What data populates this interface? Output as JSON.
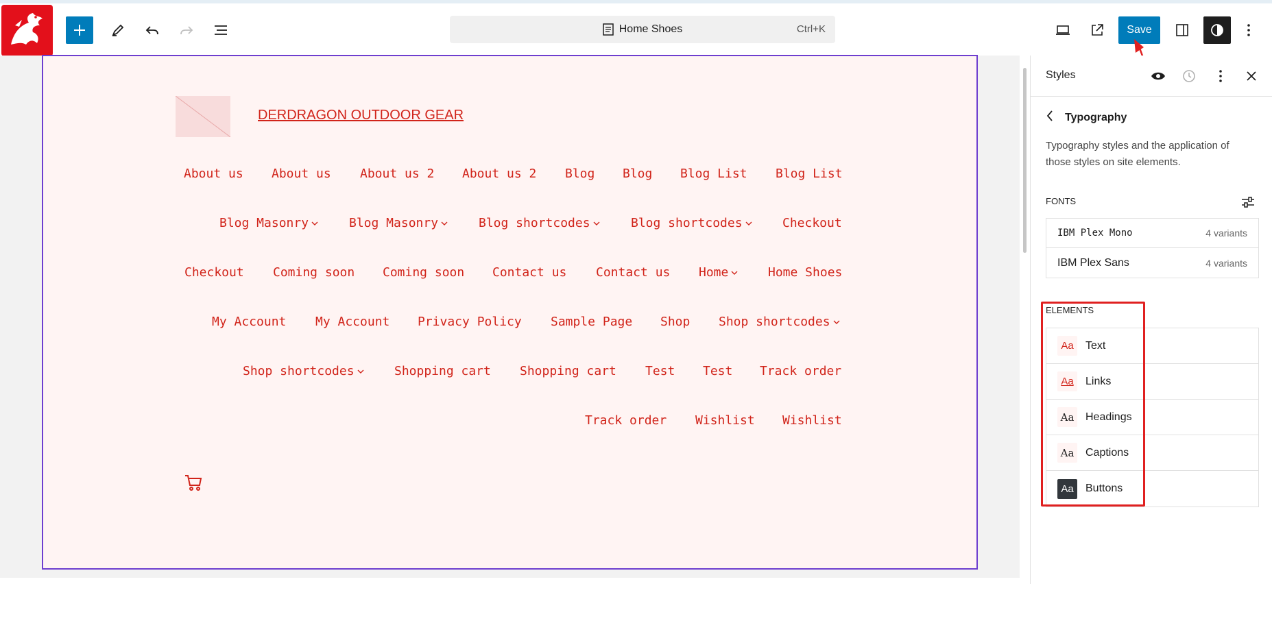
{
  "toolbar": {
    "document_title": "Home Shoes",
    "shortcut": "Ctrl+K",
    "save_label": "Save"
  },
  "site": {
    "title": "DERDRAGON OUTDOOR GEAR",
    "nav_items": [
      {
        "label": "About us",
        "has_submenu": false
      },
      {
        "label": "About us",
        "has_submenu": false
      },
      {
        "label": "About us 2",
        "has_submenu": false
      },
      {
        "label": "About us 2",
        "has_submenu": false
      },
      {
        "label": "Blog",
        "has_submenu": false
      },
      {
        "label": "Blog",
        "has_submenu": false
      },
      {
        "label": "Blog List",
        "has_submenu": false
      },
      {
        "label": "Blog List",
        "has_submenu": false
      },
      {
        "label": "Blog Masonry",
        "has_submenu": true
      },
      {
        "label": "Blog Masonry",
        "has_submenu": true
      },
      {
        "label": "Blog shortcodes",
        "has_submenu": true
      },
      {
        "label": "Blog shortcodes",
        "has_submenu": true
      },
      {
        "label": "Checkout",
        "has_submenu": false
      },
      {
        "label": "Checkout",
        "has_submenu": false
      },
      {
        "label": "Coming soon",
        "has_submenu": false
      },
      {
        "label": "Coming soon",
        "has_submenu": false
      },
      {
        "label": "Contact us",
        "has_submenu": false
      },
      {
        "label": "Contact us",
        "has_submenu": false
      },
      {
        "label": "Home",
        "has_submenu": true
      },
      {
        "label": "Home Shoes",
        "has_submenu": false
      },
      {
        "label": "My Account",
        "has_submenu": false
      },
      {
        "label": "My Account",
        "has_submenu": false
      },
      {
        "label": "Privacy Policy",
        "has_submenu": false
      },
      {
        "label": "Sample Page",
        "has_submenu": false
      },
      {
        "label": "Shop",
        "has_submenu": false
      },
      {
        "label": "Shop shortcodes",
        "has_submenu": true
      },
      {
        "label": "Shop shortcodes",
        "has_submenu": true
      },
      {
        "label": "Shopping cart",
        "has_submenu": false
      },
      {
        "label": "Shopping cart",
        "has_submenu": false
      },
      {
        "label": "Test",
        "has_submenu": false
      },
      {
        "label": "Test",
        "has_submenu": false
      },
      {
        "label": "Track order",
        "has_submenu": false
      },
      {
        "label": "Track order",
        "has_submenu": false
      },
      {
        "label": "Wishlist",
        "has_submenu": false
      },
      {
        "label": "Wishlist",
        "has_submenu": false
      }
    ]
  },
  "sidebar": {
    "title": "Styles",
    "panel_title": "Typography",
    "description": "Typography styles and the application of those styles on site elements.",
    "fonts_label": "FONTS",
    "fonts": [
      {
        "name": "IBM Plex Mono",
        "variants": "4 variants"
      },
      {
        "name": "IBM Plex Sans",
        "variants": "4 variants"
      }
    ],
    "elements_label": "ELEMENTS",
    "elements": [
      {
        "badge": "Aa",
        "label": "Text"
      },
      {
        "badge": "Aa",
        "label": "Links"
      },
      {
        "badge": "Aa",
        "label": "Headings"
      },
      {
        "badge": "Aa",
        "label": "Captions"
      },
      {
        "badge": "Aa",
        "label": "Buttons"
      }
    ]
  },
  "colors": {
    "accent": "#007cba",
    "site_text": "#d1241a",
    "canvas_bg": "#fff4f3",
    "annotation": "#e02020"
  }
}
